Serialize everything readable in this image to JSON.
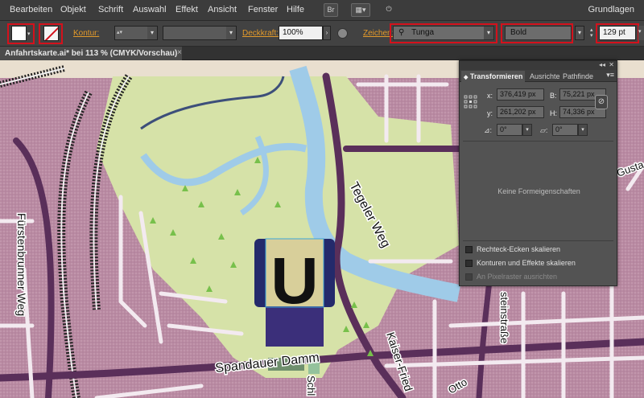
{
  "menu": {
    "items": [
      "Bearbeiten",
      "Objekt",
      "Schrift",
      "Auswahl",
      "Effekt",
      "Ansicht",
      "Fenster",
      "Hilfe"
    ],
    "bridge_icon": "Br",
    "workspace": "Grundlagen"
  },
  "controlbar": {
    "kontur_label": "Kontur:",
    "deckkraft_label": "Deckkraft:",
    "deckkraft_value": "100%",
    "zeichen_label": "Zeichen:",
    "font_family": "Tunga",
    "font_style": "Bold",
    "font_size": "129 pt"
  },
  "document": {
    "tab_title": "Anfahrtskarte.ai* bei 113 % (CMYK/Vorschau)",
    "close": "×"
  },
  "map": {
    "labels": {
      "tegeler_weg": "Tegeler Weg",
      "fuerstenbrunner_weg": "Fürstenbrunner Weg",
      "spandauer_damm": "Spandauer Damm",
      "kaiser_fried": "Kaiser-Fried",
      "steinstrasse": "steinstraße",
      "otto": "Otto",
      "schl": "Schl",
      "gusta": "Gusta"
    },
    "ubahn_letter": "U"
  },
  "transform_panel": {
    "tabs": [
      "Transformieren",
      "Ausrichte",
      "Pathfinde"
    ],
    "x_label": "x:",
    "x_value": "376,419 px",
    "y_label": "y:",
    "y_value": "261,202 px",
    "b_label": "B:",
    "b_value": "75,221 px",
    "h_label": "H:",
    "h_value": "74,336 px",
    "rotate_value": "0°",
    "shear_value": "0°",
    "no_shape_props": "Keine Formeigenschaften",
    "check_corners": "Rechteck-Ecken skalieren",
    "check_strokes": "Konturen und Effekte skalieren",
    "check_pixel": "An Pixelraster ausrichten"
  },
  "colors": {
    "accent_orange": "#e39a2a",
    "highlight_red": "#d4111c",
    "ui_dark": "#3c3c3c",
    "map_pink": "#b77f9b",
    "park_green": "#d4e0a6",
    "water_blue": "#9fcbe8",
    "road_purple": "#5a2f5a",
    "ubahn_blue": "#242a6b"
  }
}
